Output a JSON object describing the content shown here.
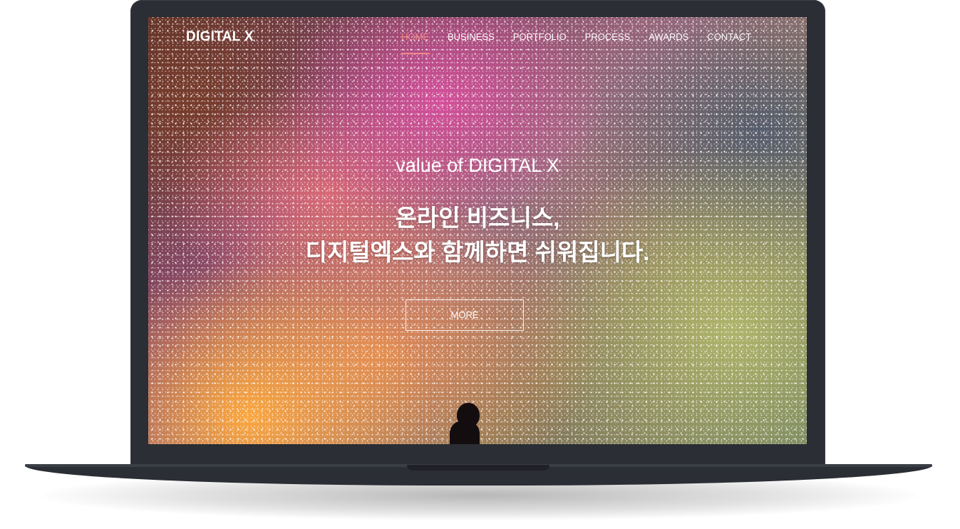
{
  "site": {
    "logo": "DIGITAL X"
  },
  "nav": {
    "items": [
      {
        "label": "HOME",
        "active": true
      },
      {
        "label": "BUSINESS",
        "active": false
      },
      {
        "label": "PORTFOLIO",
        "active": false
      },
      {
        "label": "PROCESS",
        "active": false
      },
      {
        "label": "AWARDS",
        "active": false
      },
      {
        "label": "CONTACT",
        "active": false
      }
    ],
    "active_color": "#f08a8a"
  },
  "hero": {
    "subtitle": "value of DIGITAL X",
    "title_line1": "온라인 비즈니스,",
    "title_line2": "디지털엑스와 함께하면 쉬워집니다.",
    "button_label": "MORE"
  },
  "device": {
    "frame_color": "#2b2e34"
  }
}
